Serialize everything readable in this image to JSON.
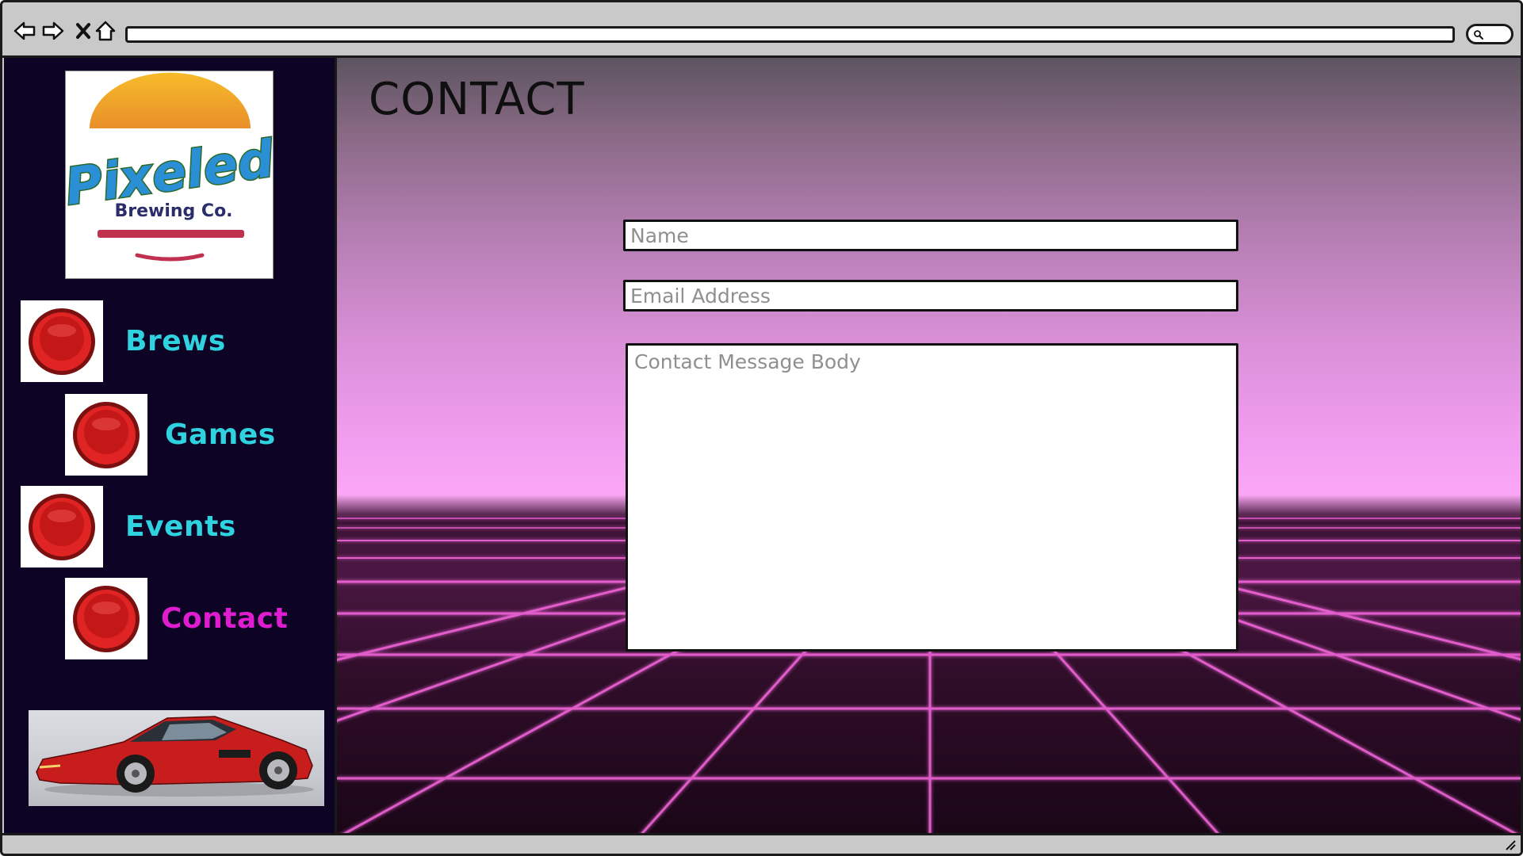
{
  "browser": {
    "back_icon": "arrow-left-icon",
    "forward_icon": "arrow-right-icon",
    "stop_icon": "close-icon",
    "home_icon": "home-icon",
    "search_icon": "search-icon"
  },
  "sidebar": {
    "logo": {
      "brand_name": "Pixeled",
      "brand_sub": "Brewing Co."
    },
    "nav": [
      {
        "label": "Brews",
        "active": false
      },
      {
        "label": "Games",
        "active": false
      },
      {
        "label": "Events",
        "active": false
      },
      {
        "label": "Contact",
        "active": true
      }
    ],
    "promo_image": "red-sports-car-image"
  },
  "main": {
    "title": "CONTACT",
    "form": {
      "name_placeholder": "Name",
      "email_placeholder": "Email Address",
      "message_placeholder": "Contact Message Body"
    }
  },
  "colors": {
    "sidebar_bg": "#0d0425",
    "nav_label": "#2fd3e0",
    "nav_label_active": "#e01cd0",
    "button_red": "#d61f1f",
    "grid_line": "#ff5fe0"
  }
}
